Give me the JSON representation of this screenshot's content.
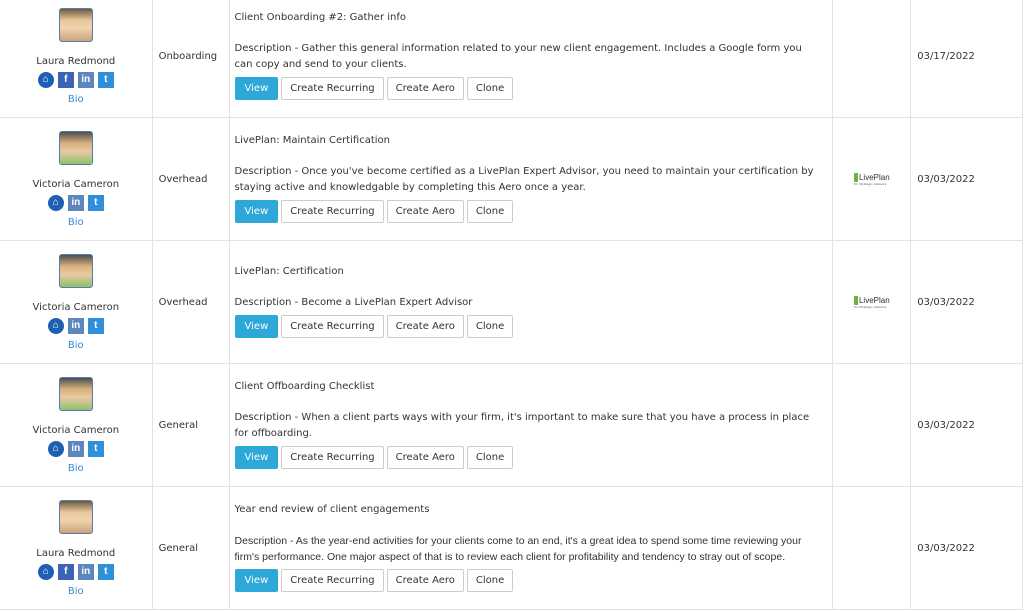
{
  "buttons": {
    "view": "View",
    "create_recurring": "Create Recurring",
    "create_aero": "Create Aero",
    "clone": "Clone"
  },
  "bio_label": "Bio",
  "logo_label": "LivePlan",
  "logo_sub": "for Strategic Advisors",
  "rows": [
    {
      "user": "Laura Redmond",
      "category": "Onboarding",
      "title": "Client Onboarding #2: Gather info",
      "description": "Description - Gather this general information related to your new client engagement. Includes a Google form you can copy and send to your clients.",
      "date": "03/17/2022"
    },
    {
      "user": "Victoria Cameron",
      "category": "Overhead",
      "title": "LivePlan: Maintain Certification",
      "description": "Description - Once you've become certified as a LivePlan Expert Advisor, you need to maintain your certification by staying active and knowledgable by completing this Aero once a year.",
      "date": "03/03/2022"
    },
    {
      "user": "Victoria Cameron",
      "category": "Overhead",
      "title": "LivePlan: Certification",
      "description": "Description - Become a LivePlan Expert Advisor",
      "date": "03/03/2022"
    },
    {
      "user": "Victoria Cameron",
      "category": "General",
      "title": "Client Offboarding Checklist",
      "description": "Description - When a client parts ways with your firm, it's important to make sure that you have a process in place for offboarding.",
      "date": "03/03/2022"
    },
    {
      "user": "Laura Redmond",
      "category": "General",
      "title": "Year end review of client engagements",
      "description": "Description - As the year-end activities for your clients come to an end, it's a great idea to spend some time reviewing your firm's performance. One major aspect of that is to review each client for profitability and tendency to stray out of scope.",
      "date": "03/03/2022"
    }
  ]
}
